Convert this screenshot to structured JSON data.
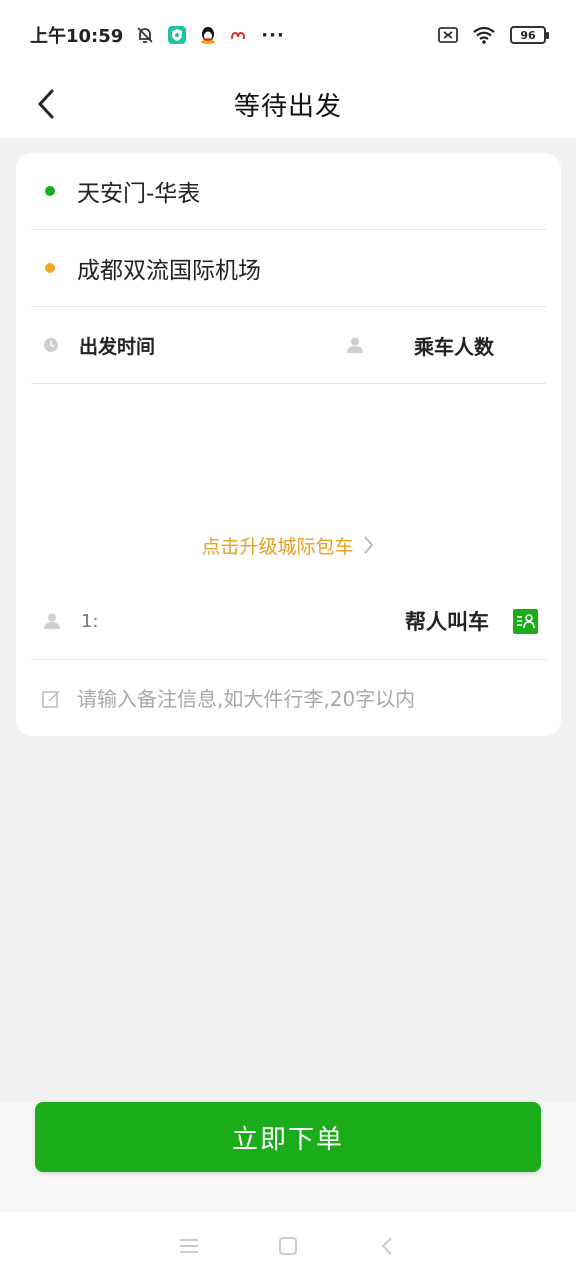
{
  "status_bar": {
    "time": "上午10:59",
    "more": "···",
    "battery": "96"
  },
  "header": {
    "title": "等待出发"
  },
  "trip": {
    "origin": "天安门-华表",
    "destination": "成都双流国际机场",
    "origin_color": "#1aad19",
    "destination_color": "#f5a623"
  },
  "options": {
    "departure_time_label": "出发时间",
    "passengers_label": "乘车人数"
  },
  "upgrade": {
    "label": "点击升级城际包车",
    "color": "#e8a020"
  },
  "rider": {
    "name": "1:",
    "call_for_others_label": "帮人叫车"
  },
  "remark": {
    "placeholder": "请输入备注信息,如大件行李,20字以内"
  },
  "actions": {
    "order_now_label": "立即下单",
    "accent_color": "#1aad19"
  }
}
